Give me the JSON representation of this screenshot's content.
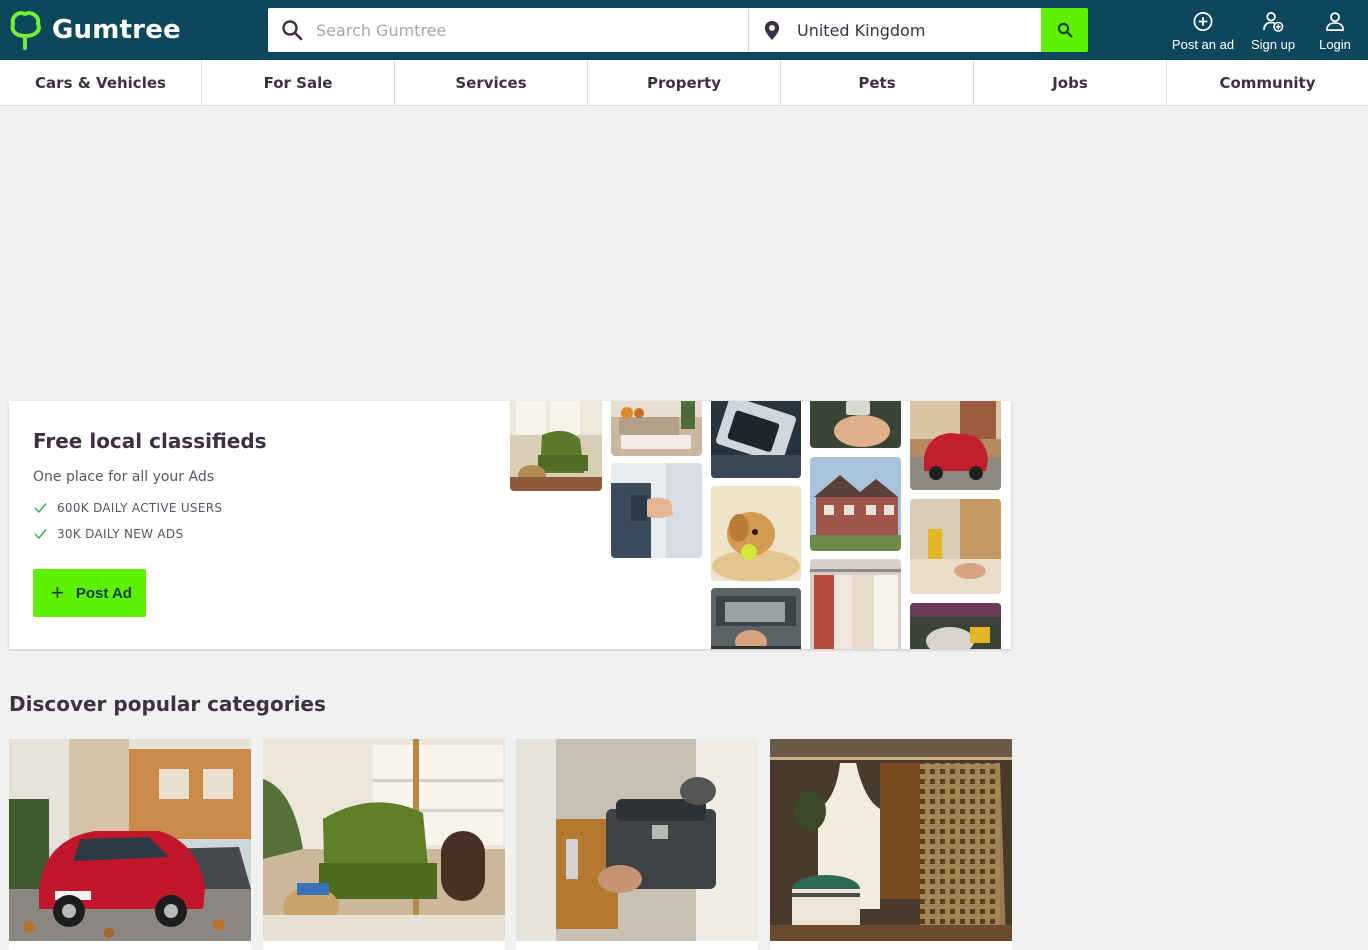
{
  "header": {
    "logo_text": "Gumtree",
    "search": {
      "placeholder": "Search Gumtree",
      "value": ""
    },
    "location": {
      "value": "United Kingdom"
    },
    "actions": [
      {
        "label": "Post an ad",
        "icon": "plus-circle-icon"
      },
      {
        "label": "Sign up",
        "icon": "user-add-icon"
      },
      {
        "label": "Login",
        "icon": "user-icon"
      }
    ],
    "colors": {
      "bar": "#0d475c",
      "accent": "#5cf100"
    }
  },
  "categories": [
    {
      "label": "Cars & Vehicles"
    },
    {
      "label": "For Sale"
    },
    {
      "label": "Services"
    },
    {
      "label": "Property"
    },
    {
      "label": "Pets"
    },
    {
      "label": "Jobs"
    },
    {
      "label": "Community"
    }
  ],
  "hero": {
    "title": "Free local classifieds",
    "subtitle": "One place for all your Ads",
    "features": [
      "600K DAILY ACTIVE USERS",
      "30K DAILY NEW ADS"
    ],
    "post_button": "Post Ad"
  },
  "popular": {
    "title": "Discover popular categories",
    "cards": [
      {
        "image": "red-car-photo"
      },
      {
        "image": "green-armchair-photo"
      },
      {
        "image": "toolbox-worker-photo"
      },
      {
        "image": "kids-clothes-photo"
      }
    ]
  }
}
